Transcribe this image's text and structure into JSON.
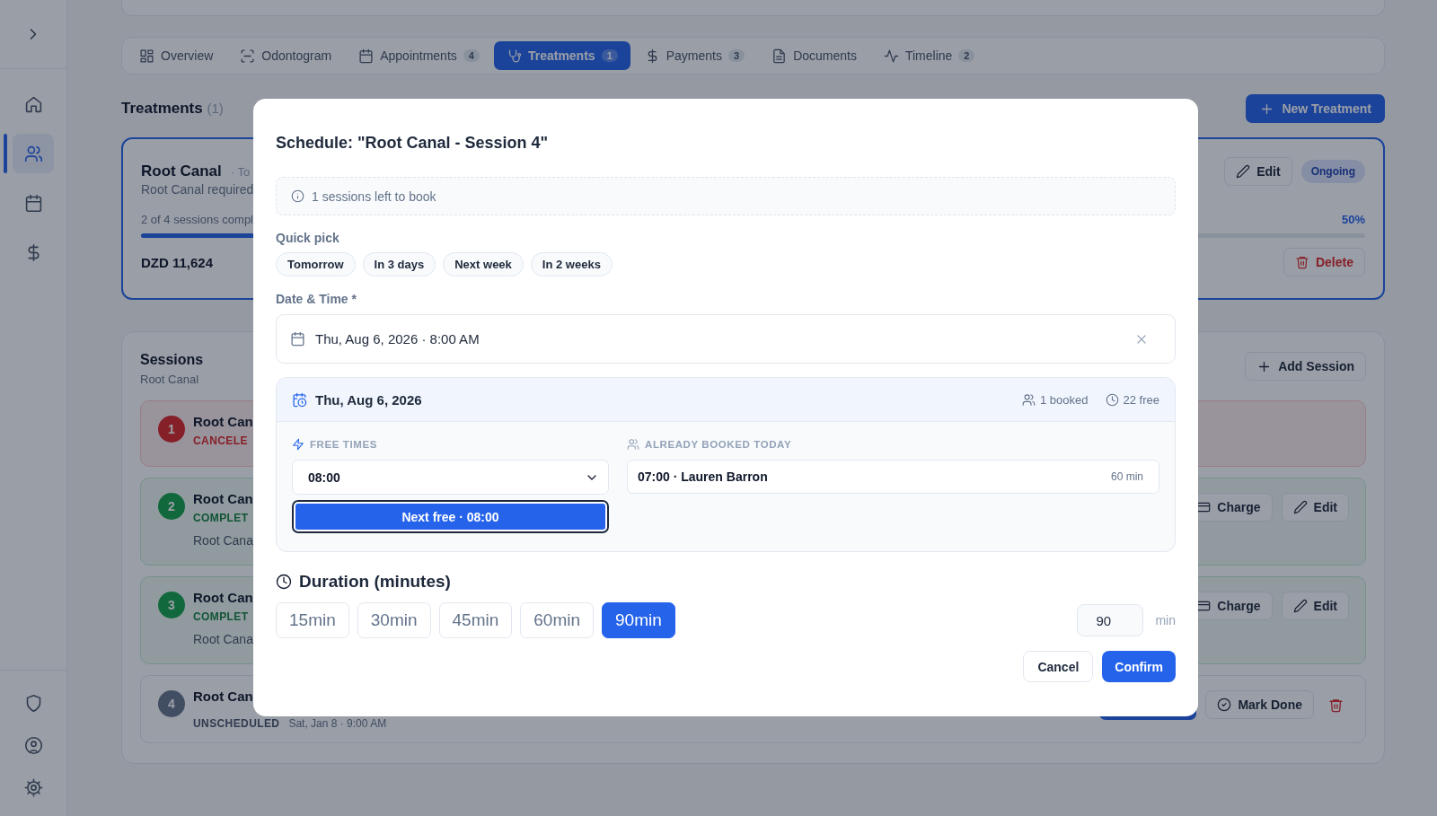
{
  "sidebar": {
    "toggle": {
      "expanded": false
    },
    "items": [
      {
        "selected": false
      },
      {
        "selected": true
      },
      {
        "selected": false
      },
      {
        "selected": false
      }
    ],
    "bottom_items": [
      {
        "selected": false
      },
      {
        "selected": false
      },
      {
        "selected": false
      }
    ]
  },
  "tabs": [
    {
      "label": "Overview",
      "selected": false
    },
    {
      "label": "Odontogram",
      "selected": false
    },
    {
      "label": "Appointments",
      "count": "4",
      "selected": false
    },
    {
      "label": "Treatments",
      "count": "1",
      "selected": true
    },
    {
      "label": "Payments",
      "count": "3",
      "selected": false
    },
    {
      "label": "Documents",
      "selected": false
    },
    {
      "label": "Timeline",
      "count": "2",
      "selected": false
    }
  ],
  "treatments": {
    "title": "Treatments",
    "count": "(1)",
    "new_button": "New Treatment",
    "card": {
      "name": "Root Canal",
      "meta": "· To",
      "description": "Root Canal required",
      "progress_text": "2 of 4 sessions compl",
      "percent": "50%",
      "level": 0.5,
      "price": "DZD 11,624",
      "edit": "Edit",
      "status": "Ongoing",
      "delete": "Delete"
    }
  },
  "sessions": {
    "title": "Sessions",
    "subtitle": "Root Canal",
    "add_button": "Add Session",
    "rows": [
      {
        "number": "1",
        "title": "Root Can",
        "kind": "canceled",
        "status": "CANCELE",
        "actions": []
      },
      {
        "number": "2",
        "title": "Root Can",
        "kind": "completed",
        "status": "COMPLET",
        "note": "Root Cana",
        "actions": [
          {
            "kind": "charge",
            "label": "Charge"
          },
          {
            "kind": "edit",
            "label": "Edit"
          }
        ]
      },
      {
        "number": "3",
        "title": "Root Can",
        "kind": "completed",
        "status": "COMPLET",
        "note": "Root Cana",
        "actions": [
          {
            "kind": "charge",
            "label": "Charge"
          },
          {
            "kind": "edit",
            "label": "Edit"
          }
        ]
      },
      {
        "number": "4",
        "title": "Root Can",
        "kind": "unscheduled",
        "status": "UNSCHEDULED",
        "date": "Sat, Jan 8 · 9:00 AM",
        "actions": [
          {
            "kind": "primary"
          },
          {
            "kind": "done",
            "label": "Mark Done"
          },
          {
            "kind": "delete"
          }
        ]
      }
    ]
  },
  "modal": {
    "title": "Schedule: \"Root Canal - Session 4\"",
    "info": "1 sessions left to book",
    "quick_pick_label": "Quick pick",
    "quick_picks": [
      "Tomorrow",
      "In 3 days",
      "Next week",
      "In 2 weeks"
    ],
    "date_label": "Date & Time *",
    "date_value": "Thu, Aug 6, 2026 · 8:00 AM",
    "day": {
      "date": "Thu, Aug 6, 2026",
      "booked": "1 booked",
      "free": "22 free",
      "free_times_label": "FREE TIMES",
      "time_value": "08:00",
      "next_free": "Next free · 08:00",
      "booked_label": "ALREADY BOOKED TODAY",
      "bookings": [
        {
          "text": "07:00 · Lauren Barron",
          "duration": "60 min"
        }
      ]
    },
    "duration": {
      "title": "Duration (minutes)",
      "options": [
        {
          "label": "15min",
          "selected": false
        },
        {
          "label": "30min",
          "selected": false
        },
        {
          "label": "45min",
          "selected": false
        },
        {
          "label": "60min",
          "selected": false
        },
        {
          "label": "90min",
          "selected": true
        }
      ],
      "value": "90",
      "unit": "min"
    },
    "cancel": "Cancel",
    "confirm": "Confirm"
  }
}
